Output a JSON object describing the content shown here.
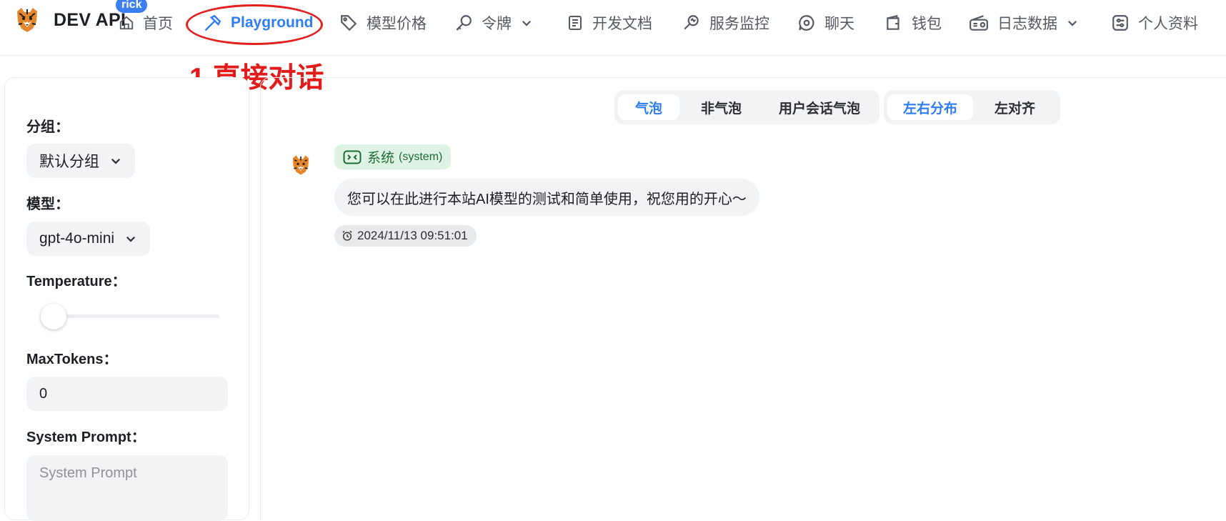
{
  "app": {
    "brand": "DEV API",
    "user_badge": "rick"
  },
  "nav": {
    "items": [
      {
        "label": "首页",
        "icon": "home-icon"
      },
      {
        "label": "Playground",
        "icon": "hammer-icon",
        "active": true
      },
      {
        "label": "模型价格",
        "icon": "tag-icon"
      },
      {
        "label": "令牌",
        "icon": "key-icon",
        "dropdown": true
      },
      {
        "label": "开发文档",
        "icon": "document-icon"
      },
      {
        "label": "服务监控",
        "icon": "monitor-icon"
      },
      {
        "label": "聊天",
        "icon": "chat-icon"
      },
      {
        "label": "钱包",
        "icon": "wallet-icon"
      },
      {
        "label": "日志数据",
        "icon": "radio-icon",
        "dropdown": true
      },
      {
        "label": "个人资料",
        "icon": "settings-sliders-icon"
      }
    ]
  },
  "annotation": {
    "text": "1.直接对话"
  },
  "sidebar": {
    "group_label": "分组：",
    "group_value": "默认分组",
    "model_label": "模型：",
    "model_value": "gpt-4o-mini",
    "temperature_label": "Temperature：",
    "temperature_value": 0,
    "max_tokens_label": "MaxTokens：",
    "max_tokens_value": "0",
    "system_prompt_label": "System Prompt：",
    "system_prompt_placeholder": "System Prompt"
  },
  "view_modes": {
    "bubble_styles": [
      "气泡",
      "非气泡",
      "用户会话气泡"
    ],
    "bubble_active": 0,
    "align_styles": [
      "左右分布",
      "左对齐"
    ],
    "align_active": 0
  },
  "chat": {
    "messages": [
      {
        "role_name": "系统",
        "role_sub": "(system)",
        "text": "您可以在此进行本站AI模型的测试和简单使用，祝您用的开心～",
        "timestamp": "2024/11/13 09:51:01"
      }
    ]
  },
  "colors": {
    "accent": "#2f7ef1",
    "annotation": "#e21b1b",
    "system_tag_bg": "#dff3e4",
    "system_tag_text": "#1d6b36"
  }
}
